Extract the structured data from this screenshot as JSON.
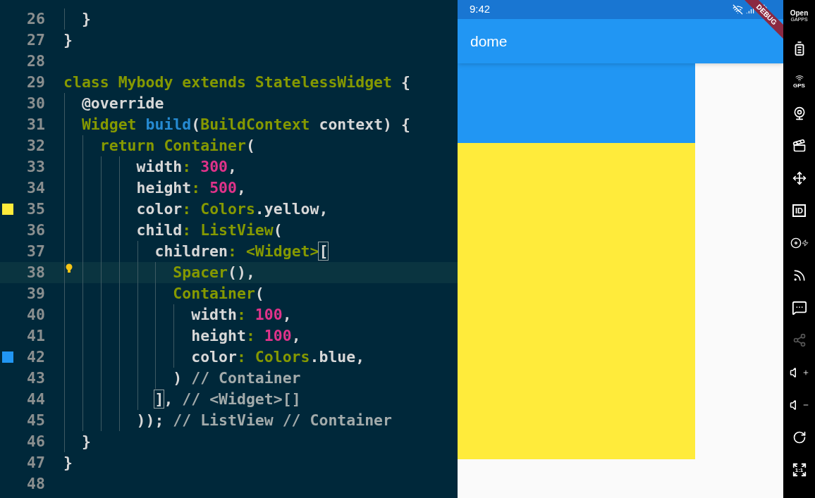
{
  "editor": {
    "lines": [
      {
        "number": "26",
        "tokens": [
          {
            "kind": "plain",
            "text": "  }"
          }
        ]
      },
      {
        "number": "27",
        "tokens": [
          {
            "kind": "plain",
            "text": "}"
          }
        ]
      },
      {
        "number": "28"
      },
      {
        "number": "29",
        "tokens": [
          {
            "kind": "keyword",
            "text": "class "
          },
          {
            "kind": "type",
            "text": "Mybody "
          },
          {
            "kind": "keyword",
            "text": "extends "
          },
          {
            "kind": "type",
            "text": "StatelessWidget"
          },
          {
            "kind": "plain",
            "text": " {"
          }
        ]
      },
      {
        "number": "30",
        "tokens": [
          {
            "kind": "plain",
            "text": "  @override"
          }
        ]
      },
      {
        "number": "31",
        "tokens": [
          {
            "kind": "type",
            "text": "  Widget "
          },
          {
            "kind": "function",
            "text": "build"
          },
          {
            "kind": "plain",
            "text": "("
          },
          {
            "kind": "type",
            "text": "BuildContext"
          },
          {
            "kind": "plain",
            "text": " context) {"
          }
        ]
      },
      {
        "number": "32",
        "tokens": [
          {
            "kind": "keyword",
            "text": "    return "
          },
          {
            "kind": "type",
            "text": "Container"
          },
          {
            "kind": "plain",
            "text": "("
          }
        ]
      },
      {
        "number": "33",
        "tokens": [
          {
            "kind": "plain",
            "text": "        width"
          },
          {
            "kind": "keyword",
            "text": ": "
          },
          {
            "kind": "number",
            "text": "300"
          },
          {
            "kind": "plain",
            "text": ","
          }
        ]
      },
      {
        "number": "34",
        "tokens": [
          {
            "kind": "plain",
            "text": "        height"
          },
          {
            "kind": "keyword",
            "text": ": "
          },
          {
            "kind": "number",
            "text": "500"
          },
          {
            "kind": "plain",
            "text": ","
          }
        ]
      },
      {
        "number": "35",
        "color": "#ffeb3b",
        "tokens": [
          {
            "kind": "plain",
            "text": "        color"
          },
          {
            "kind": "keyword",
            "text": ": "
          },
          {
            "kind": "type",
            "text": "Colors"
          },
          {
            "kind": "plain",
            "text": ".yellow,"
          }
        ]
      },
      {
        "number": "36",
        "tokens": [
          {
            "kind": "plain",
            "text": "        child"
          },
          {
            "kind": "keyword",
            "text": ": "
          },
          {
            "kind": "type",
            "text": "ListView"
          },
          {
            "kind": "plain",
            "text": "("
          }
        ]
      },
      {
        "number": "37",
        "tokens": [
          {
            "kind": "plain",
            "text": "          children"
          },
          {
            "kind": "keyword",
            "text": ": "
          },
          {
            "kind": "type",
            "text": "<Widget>"
          },
          {
            "kind": "bracket-match",
            "text": "["
          }
        ]
      },
      {
        "number": "38",
        "current": true,
        "lightbulb": true,
        "tokens": [
          {
            "kind": "type",
            "text": "            Spacer"
          },
          {
            "kind": "plain",
            "text": "(),"
          }
        ]
      },
      {
        "number": "39",
        "tokens": [
          {
            "kind": "type",
            "text": "            Container"
          },
          {
            "kind": "plain",
            "text": "("
          }
        ]
      },
      {
        "number": "40",
        "tokens": [
          {
            "kind": "plain",
            "text": "              width"
          },
          {
            "kind": "keyword",
            "text": ": "
          },
          {
            "kind": "number",
            "text": "100"
          },
          {
            "kind": "plain",
            "text": ","
          }
        ]
      },
      {
        "number": "41",
        "tokens": [
          {
            "kind": "plain",
            "text": "              height"
          },
          {
            "kind": "keyword",
            "text": ": "
          },
          {
            "kind": "number",
            "text": "100"
          },
          {
            "kind": "plain",
            "text": ","
          }
        ]
      },
      {
        "number": "42",
        "color": "#2196f3",
        "tokens": [
          {
            "kind": "plain",
            "text": "              color"
          },
          {
            "kind": "keyword",
            "text": ": "
          },
          {
            "kind": "type",
            "text": "Colors"
          },
          {
            "kind": "plain",
            "text": ".blue,"
          }
        ]
      },
      {
        "number": "43",
        "tokens": [
          {
            "kind": "plain",
            "text": "            ) "
          },
          {
            "kind": "comment",
            "text": "// Container"
          }
        ]
      },
      {
        "number": "44",
        "tokens": [
          {
            "kind": "bracket-match",
            "text": "          ]"
          },
          {
            "kind": "plain",
            "text": ", "
          },
          {
            "kind": "comment",
            "text": "// <Widget>[]"
          }
        ]
      },
      {
        "number": "45",
        "tokens": [
          {
            "kind": "plain",
            "text": "        )); "
          },
          {
            "kind": "comment",
            "text": "// ListView // Container"
          }
        ]
      },
      {
        "number": "46",
        "tokens": [
          {
            "kind": "plain",
            "text": "  }"
          }
        ]
      },
      {
        "number": "47",
        "tokens": [
          {
            "kind": "plain",
            "text": "}"
          }
        ]
      },
      {
        "number": "48"
      }
    ]
  },
  "phone": {
    "status_bar": {
      "time": "9:42"
    },
    "app_bar": {
      "title": "dome"
    },
    "debug_banner": "DEBUG"
  },
  "emulator_toolbar": [
    {
      "kind": "gapps",
      "label": "Open",
      "sublabel": "GAPPS",
      "disabled": false
    },
    {
      "kind": "battery",
      "disabled": false
    },
    {
      "kind": "gps",
      "label": "GPS",
      "disabled": false
    },
    {
      "kind": "webcam",
      "disabled": false
    },
    {
      "kind": "clapperboard",
      "disabled": false
    },
    {
      "kind": "move",
      "disabled": false
    },
    {
      "kind": "id",
      "label": "ID",
      "disabled": false
    },
    {
      "kind": "disc",
      "disabled": false
    },
    {
      "kind": "rss",
      "disabled": false
    },
    {
      "kind": "message",
      "disabled": false
    },
    {
      "kind": "share",
      "disabled": true
    },
    {
      "kind": "volume-up",
      "disabled": false
    },
    {
      "kind": "volume-down",
      "disabled": false
    },
    {
      "kind": "rotate",
      "disabled": false
    },
    {
      "kind": "expand",
      "label": "1:1",
      "disabled": false
    }
  ]
}
